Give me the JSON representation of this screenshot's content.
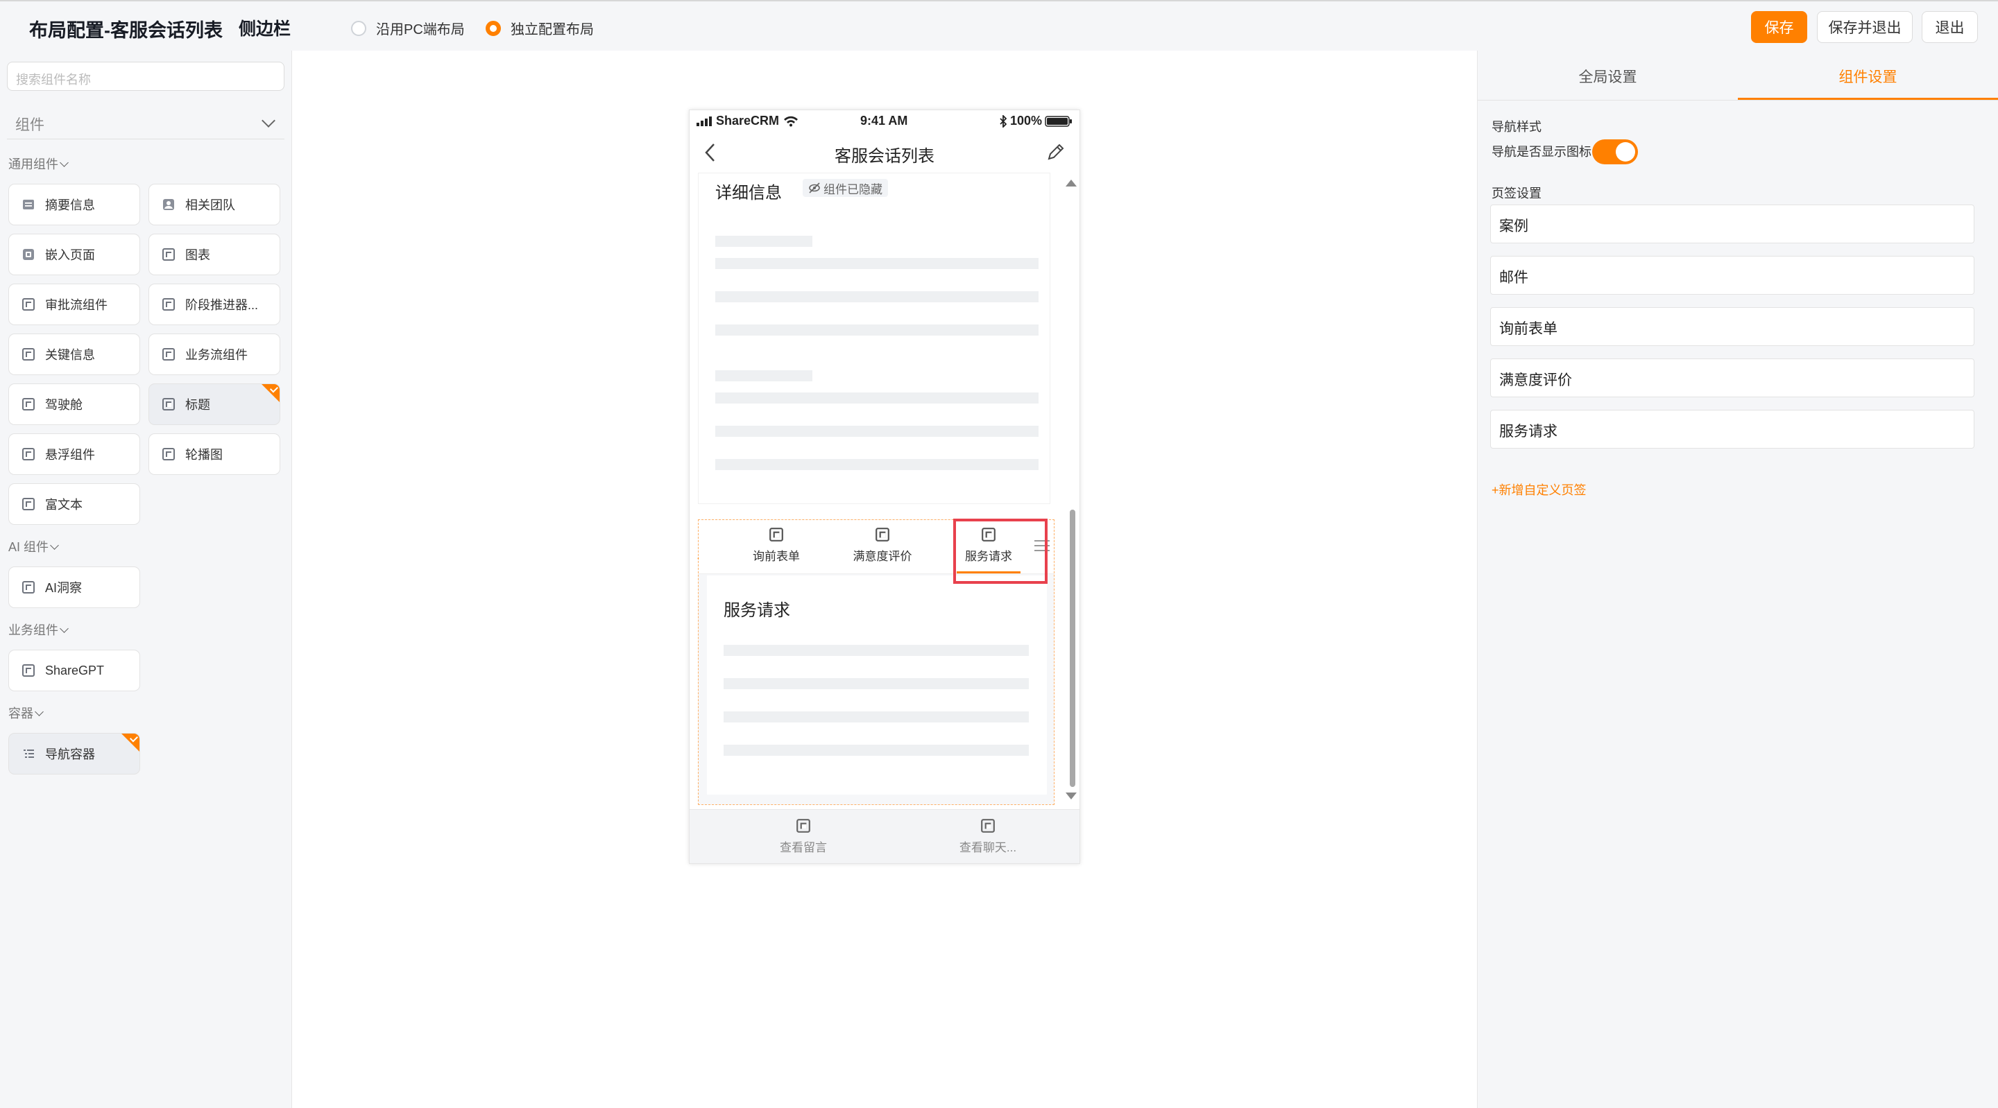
{
  "header": {
    "title": "布局配置-客服会话列表",
    "subtitle": "侧边栏",
    "layout_options": [
      {
        "label": "沿用PC端布局",
        "selected": false
      },
      {
        "label": "独立配置布局",
        "selected": true
      }
    ],
    "buttons": {
      "save": "保存",
      "save_exit": "保存并退出",
      "exit": "退出"
    },
    "accent_color": "#ff8000"
  },
  "left": {
    "search_placeholder": "搜索组件名称",
    "category_select": "组件",
    "groups": {
      "common": "通用组件",
      "ai": "AI 组件",
      "business": "业务组件",
      "container": "容器"
    },
    "items": {
      "summary": "摘要信息",
      "team": "相关团队",
      "embed": "嵌入页面",
      "chart": "图表",
      "approval": "审批流组件",
      "stage": "阶段推进器...",
      "key_info": "关键信息",
      "bizflow": "业务流组件",
      "cockpit": "驾驶舱",
      "heading": "标题",
      "float": "悬浮组件",
      "carousel": "轮播图",
      "richtext": "富文本",
      "ai_insight": "AI洞察",
      "sharegpt": "ShareGPT",
      "nav_container": "导航容器"
    }
  },
  "phone": {
    "carrier": "ShareCRM",
    "time": "9:41 AM",
    "battery": "100%",
    "page_title": "客服会话列表",
    "section_title": "详细信息",
    "hidden_badge": "组件已隐藏",
    "tabs": [
      "询前表单",
      "满意度评价",
      "服务请求"
    ],
    "active_tab": "服务请求",
    "panel_title": "服务请求",
    "bottom_buttons": [
      "查看留言",
      "查看聊天..."
    ]
  },
  "right": {
    "tabs": {
      "global": "全局设置",
      "component": "组件设置"
    },
    "nav_style_label": "导航样式",
    "show_icon_label": "导航是否显示图标",
    "show_icon_on": true,
    "tab_settings_label": "页签设置",
    "tab_fields": [
      "案例",
      "邮件",
      "询前表单",
      "满意度评价",
      "服务请求"
    ],
    "add_custom_tab": "+新增自定义页签"
  }
}
